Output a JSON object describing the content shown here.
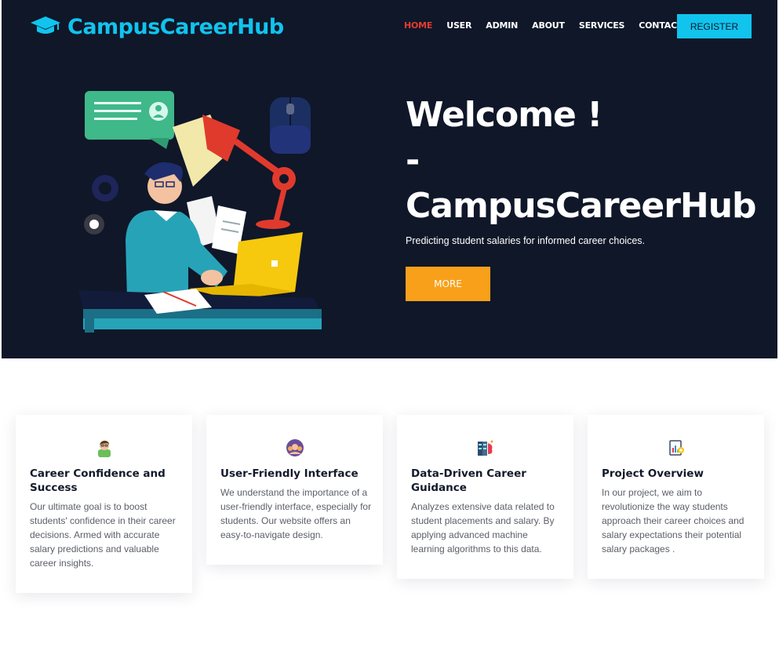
{
  "brand": {
    "name": "CampusCareerHub",
    "icon": "graduation-cap-icon",
    "color": "#10c4ee"
  },
  "nav": {
    "items": [
      {
        "label": "HOME",
        "active": true
      },
      {
        "label": "USER",
        "active": false
      },
      {
        "label": "ADMIN",
        "active": false
      },
      {
        "label": "ABOUT",
        "active": false
      },
      {
        "label": "SERVICES",
        "active": false
      },
      {
        "label": "CONTACT",
        "active": false
      }
    ],
    "register_label": "REGISTER"
  },
  "hero": {
    "title_line1": "Welcome !",
    "title_line2": "-",
    "title_line3": "CampusCareerHub",
    "subtitle": "Predicting student salaries for informed career choices.",
    "more_label": "MORE",
    "background": "#0f1729",
    "accent": "#f9a01b",
    "illustration": "student-working-at-laptop-illustration"
  },
  "cards": [
    {
      "icon": "student-avatar-icon",
      "title": "Career Confidence and Success",
      "text": "Our ultimate goal is to boost students' confidence in their career decisions. Armed with accurate salary predictions and valuable career insights."
    },
    {
      "icon": "user-group-icon",
      "title": "User-Friendly Interface",
      "text": "We understand the importance of a user-friendly interface, especially for students. Our website offers an easy-to-navigate design."
    },
    {
      "icon": "data-server-icon",
      "title": "Data-Driven Career Guidance",
      "text": "Analyzes extensive data related to student placements and salary. By applying advanced machine learning algorithms to this data."
    },
    {
      "icon": "project-report-icon",
      "title": "Project Overview",
      "text": "In our project, we aim to revolutionize the way students approach their career choices and salary expectations their potential salary packages ."
    }
  ]
}
